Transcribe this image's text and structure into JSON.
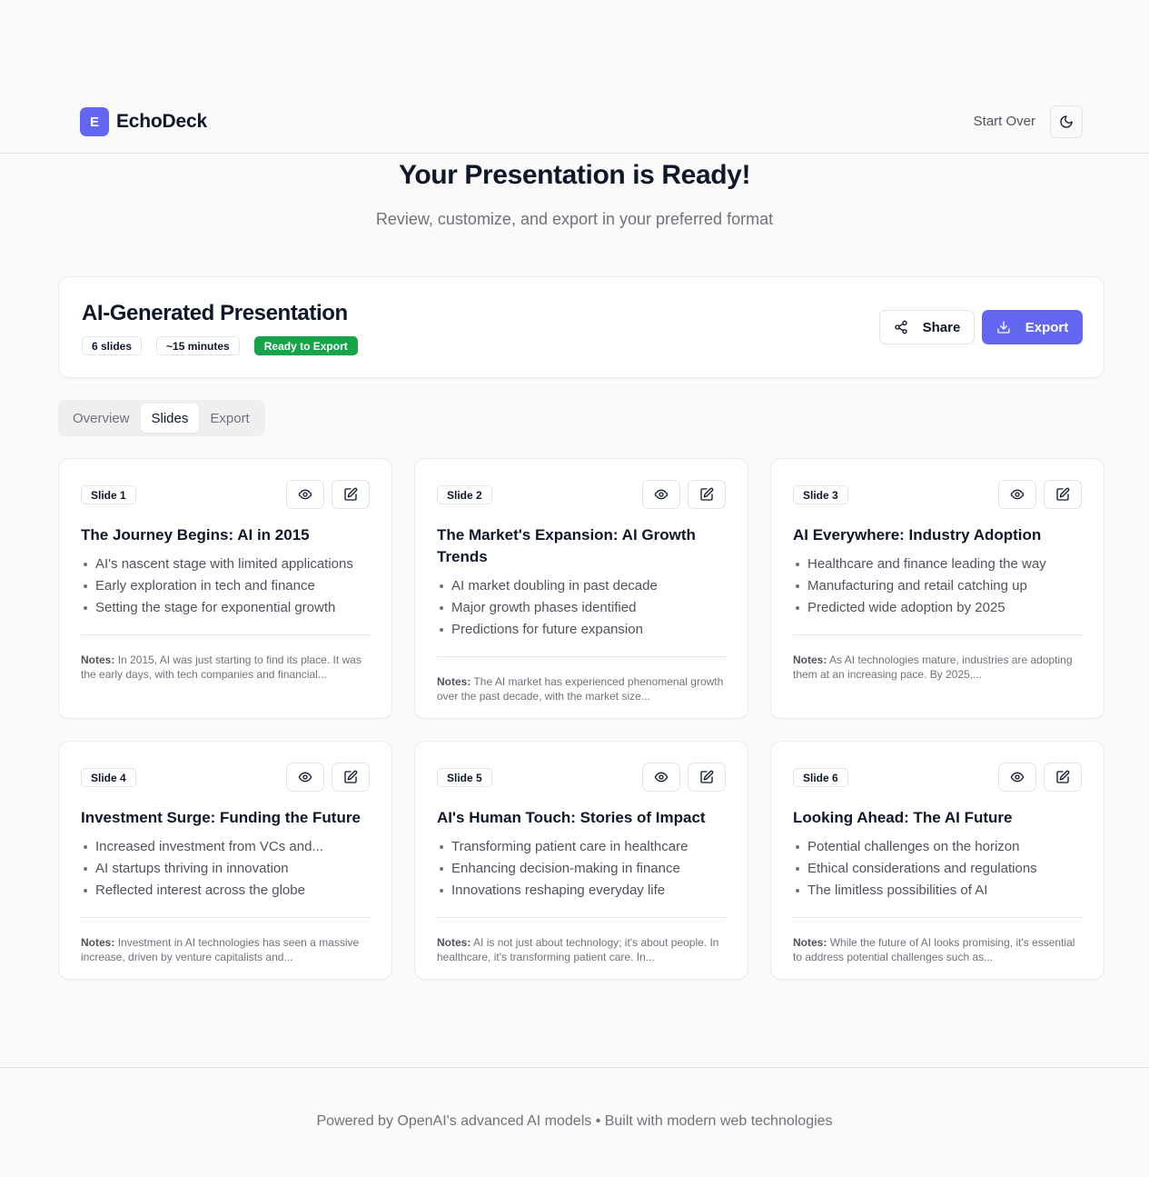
{
  "header": {
    "logo_letter": "E",
    "app_name": "EchoDeck",
    "start_over_label": "Start Over",
    "theme_icon": "moon-icon"
  },
  "hero": {
    "title": "Your Presentation is Ready!",
    "subtitle": "Review, customize, and export in your preferred format"
  },
  "presentation": {
    "title": "AI-Generated Presentation",
    "slide_count": "6 slides",
    "duration": "~15 minutes",
    "status": "Ready to Export",
    "status_color": "#16a34a",
    "share_label": "Share",
    "export_label": "Export",
    "accent_color": "#6366f1"
  },
  "tabs": [
    {
      "label": "Overview",
      "active": false
    },
    {
      "label": "Slides",
      "active": true
    },
    {
      "label": "Export",
      "active": false
    }
  ],
  "slides": [
    {
      "badge": "Slide 1",
      "title": "The Journey Begins: AI in 2015",
      "bullets": [
        "AI's nascent stage with limited applications",
        "Early exploration in tech and finance",
        "Setting the stage for exponential growth"
      ],
      "notes_label": "Notes:",
      "notes": "In 2015, AI was just starting to find its place. It was the early days, with tech companies and financial..."
    },
    {
      "badge": "Slide 2",
      "title": "The Market's Expansion: AI Growth Trends",
      "bullets": [
        "AI market doubling in past decade",
        "Major growth phases identified",
        "Predictions for future expansion"
      ],
      "notes_label": "Notes:",
      "notes": "The AI market has experienced phenomenal growth over the past decade, with the market size..."
    },
    {
      "badge": "Slide 3",
      "title": "AI Everywhere: Industry Adoption",
      "bullets": [
        "Healthcare and finance leading the way",
        "Manufacturing and retail catching up",
        "Predicted wide adoption by 2025"
      ],
      "notes_label": "Notes:",
      "notes": "As AI technologies mature, industries are adopting them at an increasing pace. By 2025,..."
    },
    {
      "badge": "Slide 4",
      "title": "Investment Surge: Funding the Future",
      "bullets": [
        "Increased investment from VCs and...",
        "AI startups thriving in innovation",
        "Reflected interest across the globe"
      ],
      "notes_label": "Notes:",
      "notes": "Investment in AI technologies has seen a massive increase, driven by venture capitalists and..."
    },
    {
      "badge": "Slide 5",
      "title": "AI's Human Touch: Stories of Impact",
      "bullets": [
        "Transforming patient care in healthcare",
        "Enhancing decision-making in finance",
        "Innovations reshaping everyday life"
      ],
      "notes_label": "Notes:",
      "notes": "AI is not just about technology; it's about people. In healthcare, it's transforming patient care. In..."
    },
    {
      "badge": "Slide 6",
      "title": "Looking Ahead: The AI Future",
      "bullets": [
        "Potential challenges on the horizon",
        "Ethical considerations and regulations",
        "The limitless possibilities of AI"
      ],
      "notes_label": "Notes:",
      "notes": "While the future of AI looks promising, it's essential to address potential challenges such as..."
    }
  ],
  "slide_icons": {
    "view": "eye-icon",
    "edit": "edit-icon"
  },
  "footer": {
    "text": "Powered by OpenAI's advanced AI models • Built with modern web technologies"
  }
}
